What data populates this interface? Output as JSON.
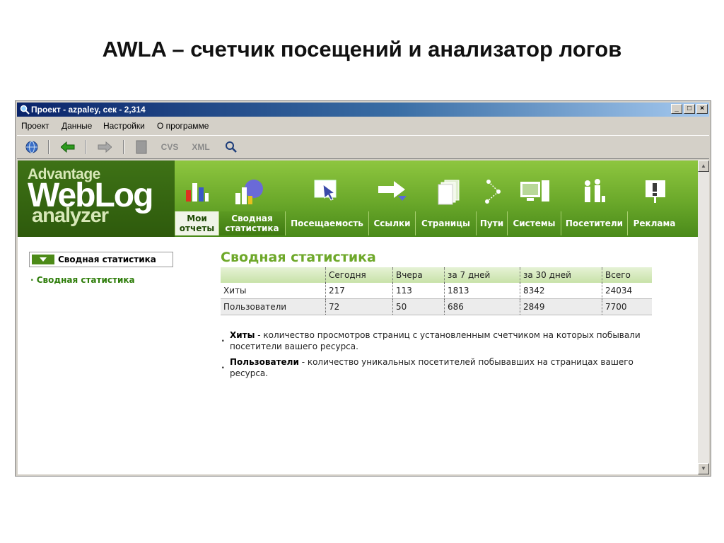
{
  "slide": {
    "title": "AWLA – счетчик посещений и анализатор логов"
  },
  "window": {
    "title": "Проект - azpaley, сек - 2,314",
    "buttons": {
      "minimize": "_",
      "maximize": "□",
      "close": "×"
    }
  },
  "menu": [
    "Проект",
    "Данные",
    "Настройки",
    "О программе"
  ],
  "toolbar": {
    "cvs_label": "CVS",
    "xml_label": "XML"
  },
  "logo": {
    "line1": "Advantage",
    "line2": "WebLog",
    "line3": "analyzer"
  },
  "nav": [
    {
      "label": "Мои отчеты",
      "icon": "bar-chart-icon"
    },
    {
      "label": "Сводная статистика",
      "icon": "pie-chart-icon"
    },
    {
      "label": "Посещаемость",
      "icon": "cursor-icon"
    },
    {
      "label": "Ссылки",
      "icon": "arrow-right-icon"
    },
    {
      "label": "Страницы",
      "icon": "pages-icon"
    },
    {
      "label": "Пути",
      "icon": "paths-icon"
    },
    {
      "label": "Системы",
      "icon": "computer-icon"
    },
    {
      "label": "Посетители",
      "icon": "people-icon"
    },
    {
      "label": "Реклама",
      "icon": "billboard-icon"
    }
  ],
  "sidebar": {
    "header": "Сводная статистика",
    "link": "Сводная статистика"
  },
  "main": {
    "title": "Сводная статистика",
    "table": {
      "headers": [
        "",
        "Сегодня",
        "Вчера",
        "за 7 дней",
        "за 30 дней",
        "Всего"
      ],
      "rows": [
        [
          "Хиты",
          "217",
          "113",
          "1813",
          "8342",
          "24034"
        ],
        [
          "Пользователи",
          "72",
          "50",
          "686",
          "2849",
          "7700"
        ]
      ]
    },
    "notes": [
      {
        "term": "Хиты",
        "text": " - количество просмотров страниц с установленным счетчиком на которых побывали посетители вашего ресурса."
      },
      {
        "term": "Пользователи",
        "text": " - количество уникальных посетителей побывавших на страницах вашего ресурса."
      }
    ]
  },
  "colors": {
    "accent": "#6ea82a",
    "banner": "#6aa82a",
    "link": "#2e7d0a"
  }
}
